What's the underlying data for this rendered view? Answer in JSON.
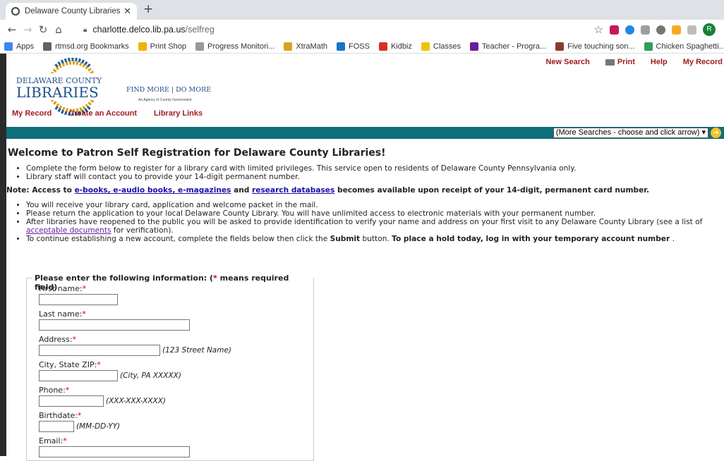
{
  "browser": {
    "tab_title": "Delaware County Libraries / All",
    "url_host": "charlotte.delco.lib.pa.us",
    "url_path": "/selfreg",
    "avatar_letter": "R",
    "bookmarks": [
      {
        "label": "Apps",
        "color": "#4285f4"
      },
      {
        "label": "rtmsd.org Bookmarks",
        "color": "#5f6368"
      },
      {
        "label": "Print Shop",
        "color": "#f2b200"
      },
      {
        "label": "Progress Monitori...",
        "color": "#999999"
      },
      {
        "label": "XtraMath",
        "color": "#d6a520"
      },
      {
        "label": "FOSS",
        "color": "#1a73c8"
      },
      {
        "label": "Kidbiz",
        "color": "#d93025"
      },
      {
        "label": "Classes",
        "color": "#f2c200"
      },
      {
        "label": "Teacher - Progra...",
        "color": "#6a1b9a"
      },
      {
        "label": "Five touching son...",
        "color": "#8b3a2a"
      },
      {
        "label": "Chicken Spaghetti...",
        "color": "#2e9e5b"
      }
    ]
  },
  "header": {
    "top_links": {
      "new_search": "New Search",
      "print": "Print",
      "help": "Help",
      "my_record": "My Record"
    },
    "sub_links": {
      "my_record": "My Record",
      "create_account": "Create an Account",
      "library_links": "Library Links"
    },
    "logo": {
      "line1": "DELAWARE COUNTY",
      "line2": "LIBRARIES",
      "tagline": "FIND MORE | DO MORE",
      "sub": "An Agency of County Government"
    },
    "search_select": "(More Searches - choose and click arrow)"
  },
  "main": {
    "title": "Welcome to Patron Self Registration for Delaware County Libraries!",
    "bullets1": [
      "Complete the form below to register for a library card with limited privileges. This service open to residents of Delaware County Pennsylvania only.",
      "Library staff will contact you to provide your 14-digit permanent number."
    ],
    "note_prefix": "Note: Access to ",
    "note_link1": "e-books, e-audio books, e-magazines",
    "note_and": " and ",
    "note_link2": "research databases",
    "note_suffix": " becomes available upon receipt of your 14-digit, permanent card number.",
    "bullet_mail": "You will receive your library card, application and welcome packet in the mail.",
    "bullet_return": "Please return the application to your local Delaware County Library. You will have unlimited access to electronic materials with your permanent number.",
    "bullet_reopen_a": "After libraries have reopened to the public you will be asked to provide identification to verify your name and address on your first visit to any Delaware County Library (see a list of ",
    "bullet_reopen_link": "acceptable documents",
    "bullet_reopen_b": " for verification).",
    "bullet_continue_a": "To continue establishing a new account, complete the fields below then click the ",
    "bullet_continue_submit": "Submit",
    "bullet_continue_b": " button. ",
    "bullet_continue_bold": "To place a hold today, log in with your temporary account number",
    "bullet_continue_end": " ."
  },
  "form": {
    "legend_prefix": "Please enter the following information: (",
    "legend_star": "*",
    "legend_suffix": " means required field)",
    "first_name": "First name:",
    "last_name": "Last name:",
    "address": "Address:",
    "address_hint": "(123 Street Name)",
    "city": "City, State ZIP:",
    "city_hint": "(City, PA XXXXX)",
    "phone": "Phone:",
    "phone_hint": "(XXX-XXX-XXXX)",
    "birthdate": "Birthdate:",
    "birthdate_hint": "(MM-DD-YY)",
    "email": "Email:",
    "star": "*"
  }
}
